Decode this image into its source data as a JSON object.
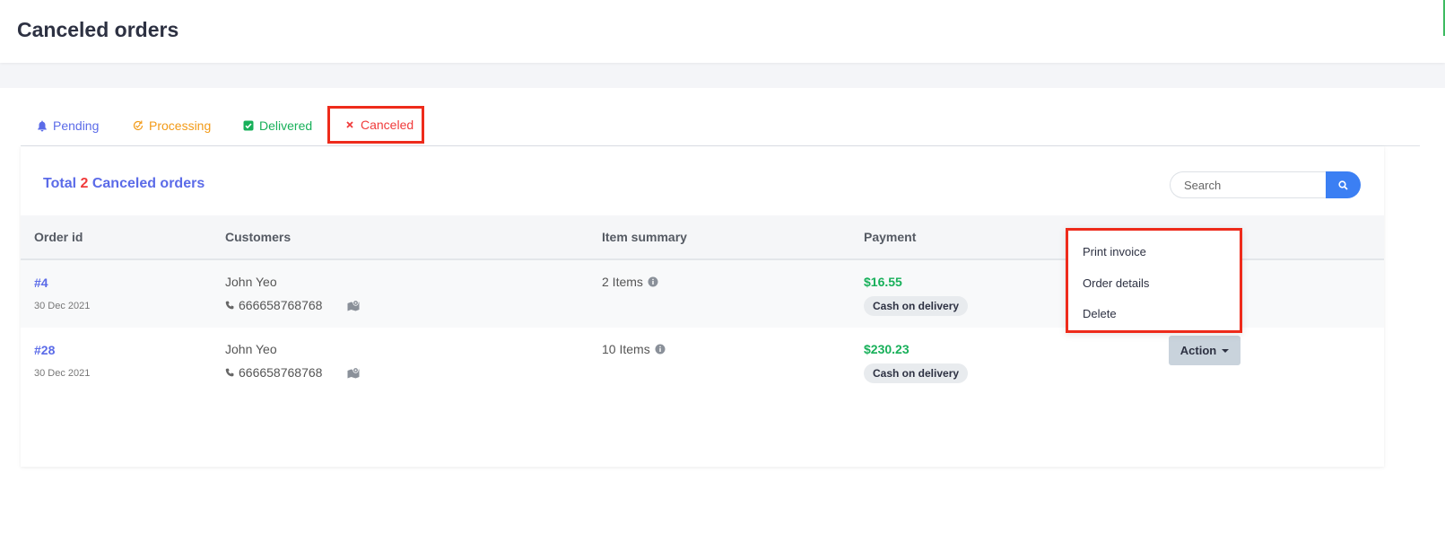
{
  "header": {
    "title": "Canceled orders"
  },
  "tabs": [
    {
      "label": "Pending",
      "icon": "bell-icon",
      "color": "#5b6be8"
    },
    {
      "label": "Processing",
      "icon": "refresh-icon",
      "color": "#f29a17"
    },
    {
      "label": "Delivered",
      "icon": "check-square-icon",
      "color": "#18b05a"
    },
    {
      "label": "Canceled",
      "icon": "close-icon",
      "color": "#f03b3b",
      "active": true
    }
  ],
  "summary": {
    "prefix": "Total",
    "count": "2",
    "suffix": "Canceled orders"
  },
  "search": {
    "placeholder": "Search",
    "value": ""
  },
  "table": {
    "columns": [
      "Order id",
      "Customers",
      "Item summary",
      "Payment"
    ],
    "rows": [
      {
        "order_id": "#4",
        "date": "30 Dec 2021",
        "customer": "John Yeo",
        "phone": "666658768768",
        "items": "2 Items",
        "amount": "$16.55",
        "payment_method": "Cash on delivery"
      },
      {
        "order_id": "#28",
        "date": "30 Dec 2021",
        "customer": "John Yeo",
        "phone": "666658768768",
        "items": "10 Items",
        "amount": "$230.23",
        "payment_method": "Cash on delivery"
      }
    ]
  },
  "action": {
    "label": "Action"
  },
  "dropdown": {
    "items": [
      "Print invoice",
      "Order details",
      "Delete"
    ]
  },
  "colors": {
    "accent": "#5b6be8",
    "danger": "#f03b3b",
    "success": "#18b05a",
    "search_button": "#3b7ff3",
    "highlight": "#ee2b1b"
  }
}
